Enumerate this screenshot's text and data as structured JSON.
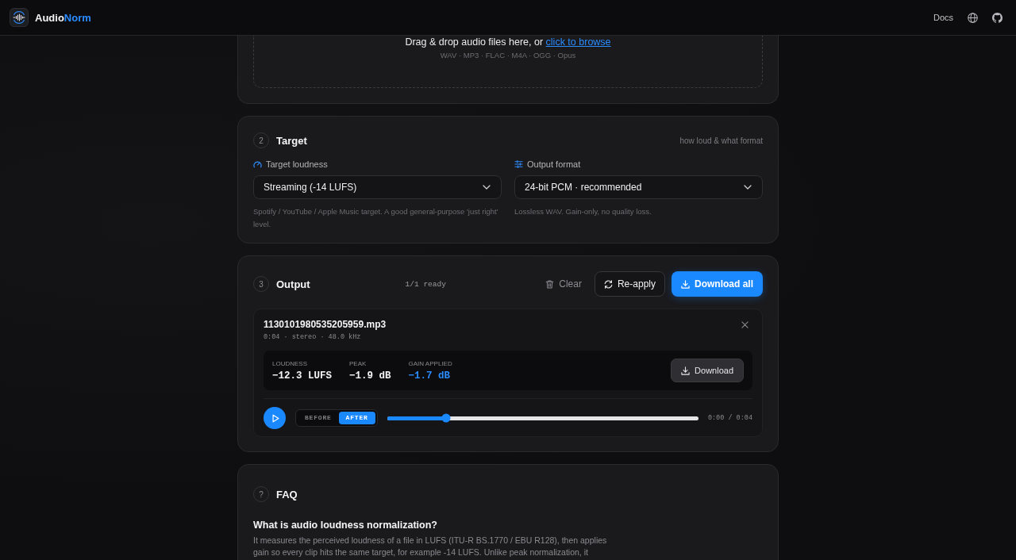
{
  "header": {
    "brand_name": "Audio",
    "brand_accent": "Norm",
    "docs_link": "Docs"
  },
  "upload": {
    "prompt": "Drag & drop audio files here, or",
    "browse_link": "click to browse",
    "formats": "WAV · MP3 · FLAC · M4A · OGG · Opus"
  },
  "target": {
    "step": "2",
    "title": "Target",
    "hint": "how loud & what format",
    "fields": [
      {
        "label": "Target loudness",
        "value": "Streaming (-14 LUFS)",
        "help": "Spotify / YouTube / Apple Music target. A good general-purpose 'just right' level."
      },
      {
        "label": "Output format",
        "value": "24-bit PCM · recommended",
        "help": "Lossless WAV. Gain-only, no quality loss."
      }
    ]
  },
  "output": {
    "step": "3",
    "title": "Output",
    "status": "1/1 ready",
    "actions": [
      {
        "kind": "ghost",
        "label": "Clear"
      },
      {
        "kind": "outline",
        "label": "Re-apply"
      },
      {
        "kind": "primary",
        "label": "Download all"
      }
    ],
    "files": [
      {
        "name": "1130101980535205959.mp3",
        "meta": "0:04 · stereo · 48.0 kHz",
        "stats": [
          {
            "label": "LOUDNESS",
            "value": "−12.3 LUFS",
            "highlight": false
          },
          {
            "label": "PEAK",
            "value": "−1.9 dB",
            "highlight": false
          },
          {
            "label": "GAIN APPLIED",
            "value": "−1.7 dB",
            "highlight": true
          }
        ],
        "download": "Download",
        "compare": [
          {
            "label": "BEFORE",
            "selected": false
          },
          {
            "label": "AFTER",
            "selected": true
          }
        ],
        "level": 0.19,
        "time": "0:00 / 0:04"
      }
    ]
  },
  "faq": {
    "step": "?",
    "title": "FAQ",
    "items": [
      {
        "question": "What is audio loudness normalization?",
        "answer": "It measures the perceived loudness of a file in LUFS (ITU-R BS.1770 / EBU R128), then applies gain so every clip hits the same target, for example -14 LUFS. Unlike peak normalization, it"
      }
    ]
  }
}
